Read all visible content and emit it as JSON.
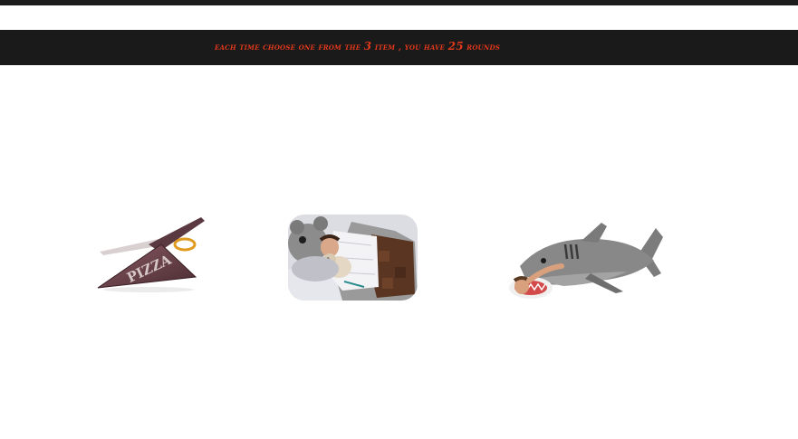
{
  "header": {
    "instruction_prefix": "each time choose one from the",
    "choice_count": "3",
    "instruction_middle": "item , you have",
    "round_count": "25",
    "instruction_suffix": "rounds"
  },
  "items": [
    {
      "icon": "pizza-scissors-image",
      "engraved_text": "PIZZA"
    },
    {
      "icon": "bear-sleeping-bag-image"
    },
    {
      "icon": "shark-sleeping-bag-image"
    }
  ],
  "colors": {
    "bar_background": "#1a1a1a",
    "instruction_text": "#e2381b",
    "page_background": "#ffffff"
  }
}
